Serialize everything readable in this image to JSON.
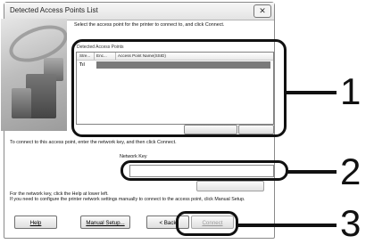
{
  "window": {
    "title": "Detected Access Points List",
    "close_glyph": "✕"
  },
  "instruction": "Select the access point for the printer to connect to, and click Connect.",
  "access_points": {
    "group_label": "Detected Access Points",
    "columns": [
      "Stre...",
      "Enc...",
      "Access Point Name(SSID)"
    ],
    "rows": [
      {
        "signal_icon": "signal-strength-icon",
        "signal_glyph": "Tıl",
        "selected": true
      }
    ]
  },
  "key_instruction": "To connect to this access point, enter the network key, and then click Connect.",
  "network_key": {
    "label": "Network Key",
    "value": ""
  },
  "help_text": "For the network key, click the Help at lower left.\nIf you need to configure the printer network settings manually to connect to the access point, click Manual Setup.",
  "buttons": {
    "help": "Help",
    "manual_setup": "Manual Setup...",
    "back": "< Back",
    "connect": "Connect"
  },
  "callouts": [
    "1",
    "2",
    "3"
  ],
  "colors": {
    "selection": "#7a7a7a",
    "highlight": "#111111",
    "disabled_text": "#9a9a9a"
  }
}
